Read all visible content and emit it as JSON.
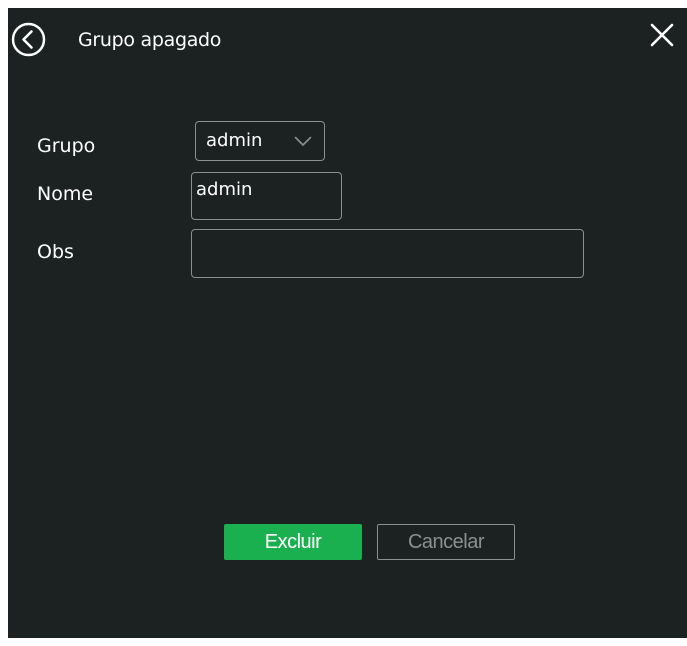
{
  "dialog": {
    "title": "Grupo apagado",
    "back_icon": "back-circle-icon",
    "close_icon": "close-icon"
  },
  "form": {
    "grupo": {
      "label": "Grupo",
      "selected": "admin",
      "icon": "chevron-down-icon"
    },
    "nome": {
      "label": "Nome",
      "value": "admin"
    },
    "obs": {
      "label": "Obs",
      "value": ""
    }
  },
  "actions": {
    "excluir_label": "Excluir",
    "cancelar_label": "Cancelar"
  },
  "colors": {
    "background": "#1c2121",
    "accent": "#1bb04f",
    "border": "#8a9090",
    "text": "#ffffff"
  }
}
